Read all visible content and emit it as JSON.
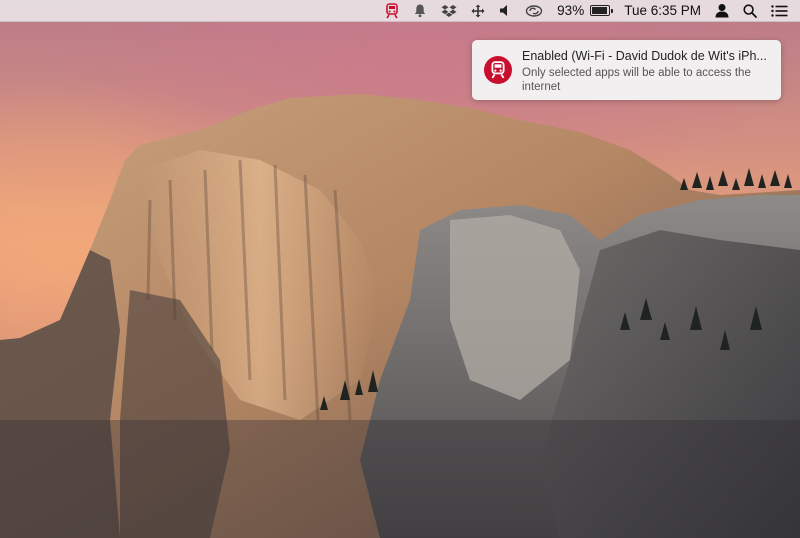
{
  "menubar": {
    "battery_percent": "93%",
    "battery_level": 0.93,
    "clock": "Tue 6:35 PM",
    "icons": [
      "train-app-icon",
      "notification-bell-icon",
      "dropbox-icon",
      "move-arrows-icon",
      "volume-icon",
      "sync-icon",
      "battery-icon",
      "user-icon",
      "spotlight-search-icon",
      "notification-center-icon"
    ],
    "accent_color": "#c8102e"
  },
  "notification": {
    "title": "Enabled (Wi-Fi - David Dudok de Wit's iPh...",
    "message": "Only selected apps will be able to access the internet",
    "icon": "train-app-icon"
  },
  "wallpaper": {
    "subject": "mountain-wallpaper"
  }
}
